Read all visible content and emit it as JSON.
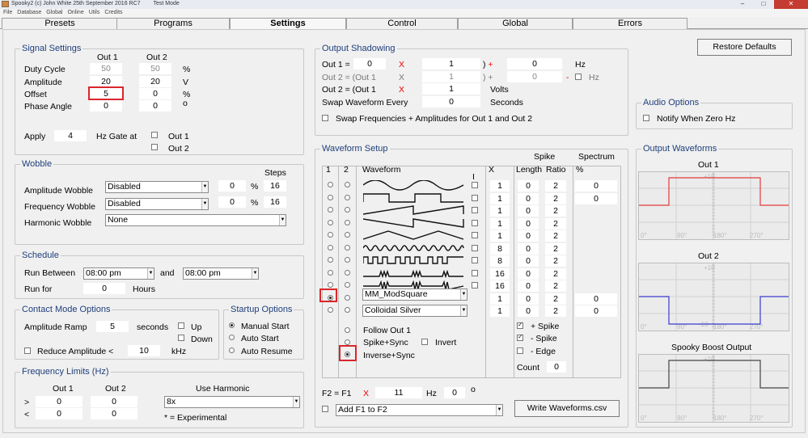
{
  "window": {
    "title": "Spooky2 (c) John White 25th September 2016 RC7",
    "mode": "Test Mode",
    "menu": [
      "File",
      "Database",
      "Global",
      "Online",
      "Utils",
      "Credits"
    ]
  },
  "tabs": [
    "Presets",
    "Programs",
    "Settings",
    "Control",
    "Global",
    "Errors"
  ],
  "restore_defaults": "Restore Defaults",
  "signal": {
    "title": "Signal Settings",
    "out1": "Out 1",
    "out2": "Out 2",
    "duty": "Duty Cycle",
    "duty1": "50",
    "duty2": "50",
    "duty_u": "%",
    "amp": "Amplitude",
    "amp1": "20",
    "amp2": "20",
    "amp_u": "V",
    "offset": "Offset",
    "off1": "5",
    "off2": "0",
    "off_u": "%",
    "phase": "Phase Angle",
    "ph1": "0",
    "ph2": "0",
    "ph_u": "o",
    "apply": "Apply",
    "apply_v": "4",
    "gate": "Hz Gate at",
    "g1": "Out 1",
    "g2": "Out 2"
  },
  "wobble": {
    "title": "Wobble",
    "steps": "Steps",
    "amp": "Amplitude Wobble",
    "amp_sel": "Disabled",
    "amp_v": "0",
    "amp_p": "%",
    "amp_s": "16",
    "freq": "Frequency Wobble",
    "freq_sel": "Disabled",
    "freq_v": "0",
    "freq_p": "%",
    "freq_s": "16",
    "harm": "Harmonic Wobble",
    "harm_sel": "None"
  },
  "schedule": {
    "title": "Schedule",
    "between": "Run Between",
    "t1": "08:00 pm",
    "and": "and",
    "t2": "08:00 pm",
    "runfor": "Run for",
    "hours_v": "0",
    "hours": "Hours"
  },
  "contact": {
    "title": "Contact Mode Options",
    "ramp": "Amplitude Ramp",
    "ramp_v": "5",
    "seconds": "seconds",
    "up": "Up",
    "down": "Down",
    "reduce": "Reduce Amplitude <",
    "reduce_v": "10",
    "khz": "kHz"
  },
  "startup": {
    "title": "Startup Options",
    "manual": "Manual Start",
    "auto": "Auto Start",
    "resume": "Auto Resume"
  },
  "freqlim": {
    "title": "Frequency Limits (Hz)",
    "out1": "Out 1",
    "out2": "Out 2",
    "use": "Use Harmonic",
    "gt": ">",
    "lt": "<",
    "a": "0",
    "b": "0",
    "c": "0",
    "d": "0",
    "harm_sel": "8x",
    "note": "* = Experimental"
  },
  "shadow": {
    "title": "Output Shadowing",
    "r1": "Out 1 =",
    "r1v": "0",
    "x": "X",
    "r1m": "1",
    "paren_plus": ") +",
    "r1a": "0",
    "hz": "Hz",
    "r2": "Out 2 = (Out 1",
    "r2m": "1",
    "r2plus": ") +",
    "r2a": "0",
    "minus": "-",
    "r2hz": "Hz",
    "r3": "Out 2 = (Out 1",
    "r3m": "1",
    "volts": "Volts",
    "swap": "Swap Waveform Every",
    "swap_v": "0",
    "secs": "Seconds",
    "swapf": "Swap Frequencies + Amplitudes for Out 1 and Out 2"
  },
  "audio": {
    "title": "Audio Options",
    "notify": "Notify When Zero Hz"
  },
  "wave": {
    "title": "Waveform Setup",
    "c1": "1",
    "c2": "2",
    "cw": "Waveform",
    "cx": "X",
    "spike": "Spike",
    "len": "Length",
    "ratio": "Ratio",
    "spectrum": "Spectrum",
    "pct": "%",
    "i_mark": "I",
    "x": [
      "1",
      "1",
      "1",
      "1",
      "1",
      "8",
      "8",
      "16",
      "16",
      "1",
      "1"
    ],
    "len_v": [
      "0",
      "0",
      "0",
      "0",
      "0",
      "0",
      "0",
      "0",
      "0",
      "0",
      "0"
    ],
    "ratio_v": [
      "2",
      "2",
      "2",
      "2",
      "2",
      "2",
      "2",
      "2",
      "2",
      "2",
      "2"
    ],
    "spec": [
      "0",
      "0",
      "",
      "",
      "",
      "",
      "",
      "",
      "",
      "0",
      "0"
    ],
    "sel1": "MM_ModSquare",
    "sel2": "Colloidal Silver",
    "follow": "Follow Out 1",
    "spikesync": "Spike+Sync",
    "invert": "Invert",
    "invsync": "Inverse+Sync",
    "pspike": "+ Spike",
    "mspike": "- Spike",
    "edge": "- Edge",
    "count": "Count",
    "count_v": "0",
    "f2": "F2 = F1",
    "fx": "X",
    "fv": "11",
    "fhz": "Hz",
    "fo": "0",
    "fdeg": "o",
    "add_sel": "Add F1 to F2",
    "write": "Write Waveforms.csv"
  },
  "outwave": {
    "title": "Output Waveforms",
    "o1": "Out 1",
    "o2": "Out 2",
    "boost": "Spooky Boost Output",
    "ax": [
      "0°",
      "90°",
      "180°",
      "270°"
    ],
    "top": "+10",
    "bot": "-10"
  },
  "colors": {
    "accent": "#1e3f7c",
    "highlight": "#d9262b",
    "out1_trace": "#e23a3a",
    "out2_trace": "#3a3ad0",
    "boost_trace": "#444444"
  }
}
